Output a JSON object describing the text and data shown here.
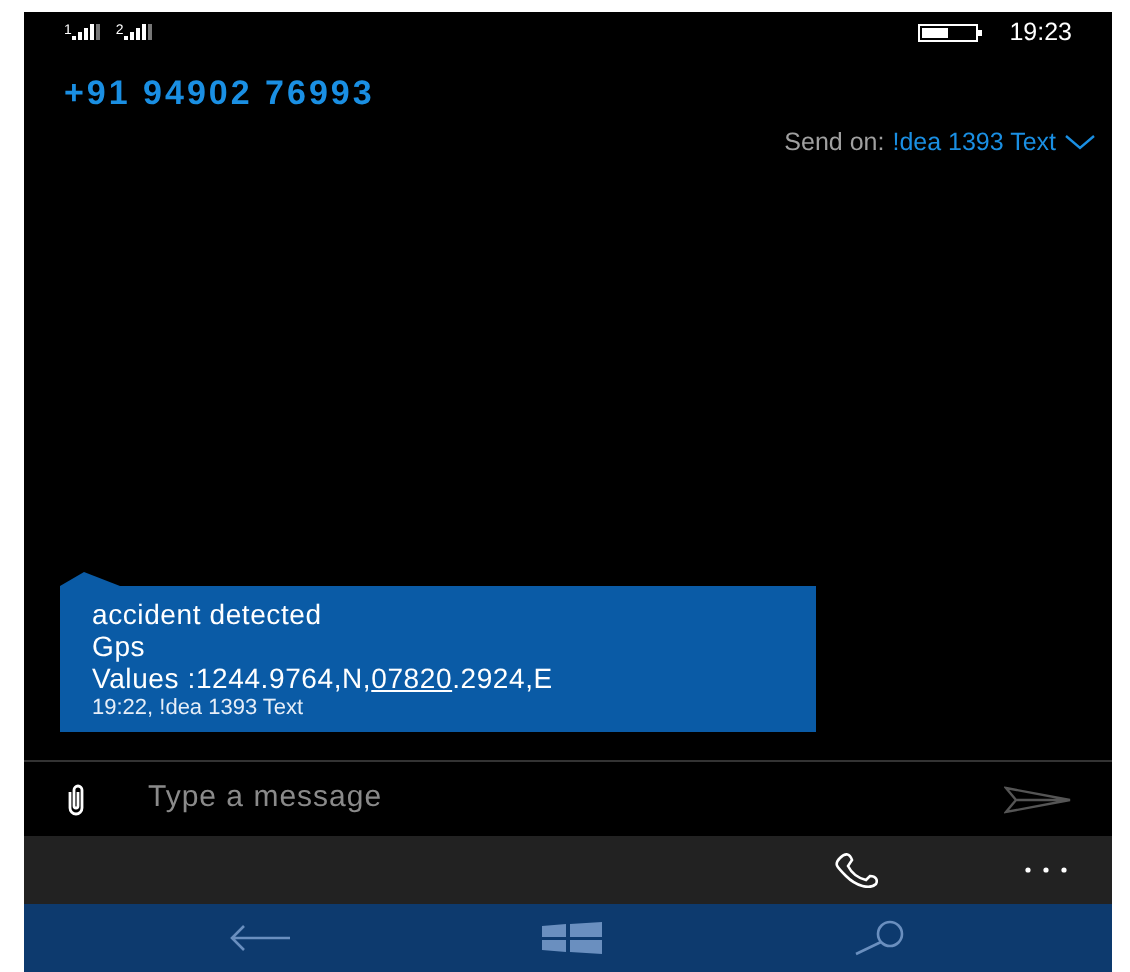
{
  "status_bar": {
    "sims": [
      "1",
      "2"
    ],
    "time": "19:23"
  },
  "header": {
    "contact": "+91 94902 76993",
    "send_on_label": "Send on:",
    "send_on_value": "!dea 1393 Text"
  },
  "message": {
    "lines": [
      {
        "segments": [
          {
            "text": "accident detected",
            "kind": "plain"
          }
        ]
      },
      {
        "segments": [
          {
            "text": "Gps",
            "kind": "plain"
          }
        ]
      },
      {
        "segments": [
          {
            "text": "Values :1244.9764,N,",
            "kind": "plain"
          },
          {
            "text": "07820",
            "kind": "link"
          },
          {
            "text": ".2924,E",
            "kind": "plain"
          }
        ]
      }
    ],
    "meta": "19:22, !dea 1393 Text"
  },
  "composer": {
    "placeholder": "Type a message"
  }
}
